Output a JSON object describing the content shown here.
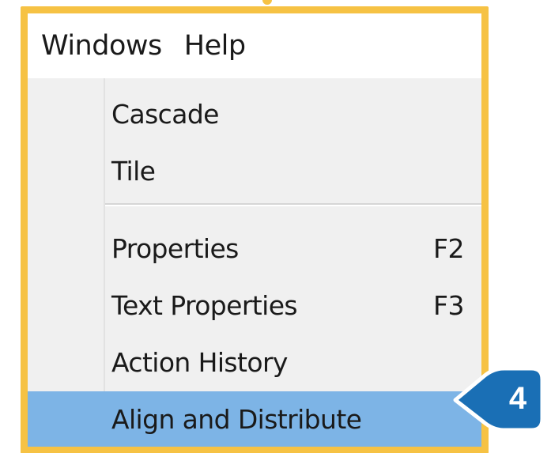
{
  "menubar": {
    "items": [
      {
        "label": "Windows"
      },
      {
        "label": "Help"
      }
    ]
  },
  "windows_menu": {
    "items": [
      {
        "label": "Cascade",
        "shortcut": ""
      },
      {
        "label": "Tile",
        "shortcut": ""
      },
      {
        "label": "Properties",
        "shortcut": "F2"
      },
      {
        "label": "Text Properties",
        "shortcut": "F3"
      },
      {
        "label": "Action History",
        "shortcut": ""
      },
      {
        "label": "Align and Distribute",
        "shortcut": "",
        "highlighted": true
      }
    ]
  },
  "callout": {
    "step": "4",
    "color": "#1a6fb5"
  },
  "colors": {
    "frame": "#f6c244",
    "highlight": "#7db4e6",
    "menu_bg": "#f0f0f0"
  }
}
